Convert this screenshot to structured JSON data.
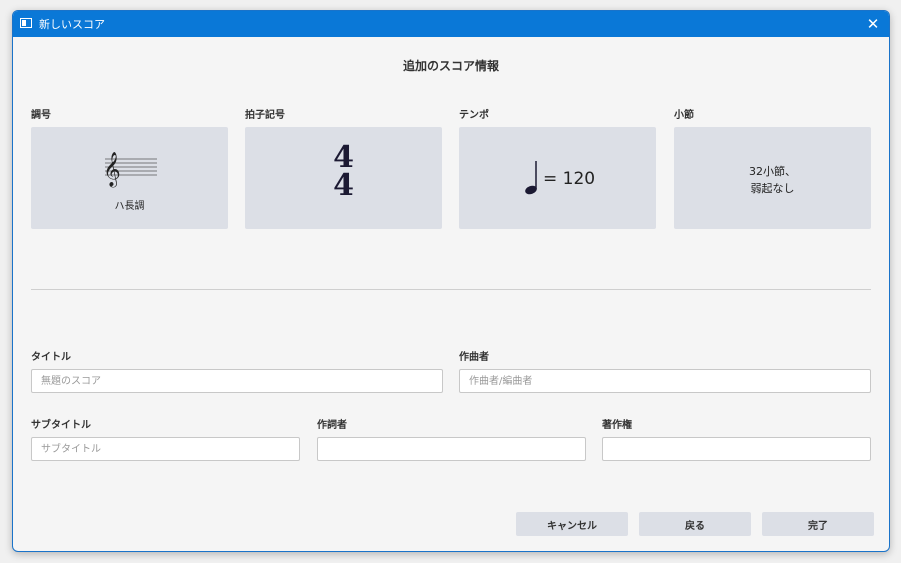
{
  "window": {
    "title": "新しいスコア"
  },
  "heading": "追加のスコア情報",
  "cards": {
    "key": {
      "label": "調号",
      "value": "ハ長調"
    },
    "time": {
      "label": "拍子記号",
      "top": "4",
      "bottom": "4"
    },
    "tempo": {
      "label": "テンポ",
      "value": "= 120"
    },
    "measures": {
      "label": "小節",
      "line1": "32小節、",
      "line2": "弱起なし"
    }
  },
  "fields": {
    "title": {
      "label": "タイトル",
      "placeholder": "無題のスコア",
      "value": ""
    },
    "composer": {
      "label": "作曲者",
      "placeholder": "作曲者/編曲者",
      "value": ""
    },
    "subtitle": {
      "label": "サブタイトル",
      "placeholder": "サブタイトル",
      "value": ""
    },
    "lyricist": {
      "label": "作詞者",
      "placeholder": "",
      "value": ""
    },
    "copyright": {
      "label": "著作権",
      "placeholder": "",
      "value": ""
    }
  },
  "buttons": {
    "cancel": "キャンセル",
    "back": "戻る",
    "finish": "完了"
  },
  "colors": {
    "titlebar": "#0a78d7",
    "card": "#dcdfe6",
    "button": "#dcdfe6"
  },
  "icons": {
    "app": "window-icon",
    "close": "close-icon",
    "clef": "treble-clef-icon",
    "note": "quarter-note-icon"
  }
}
